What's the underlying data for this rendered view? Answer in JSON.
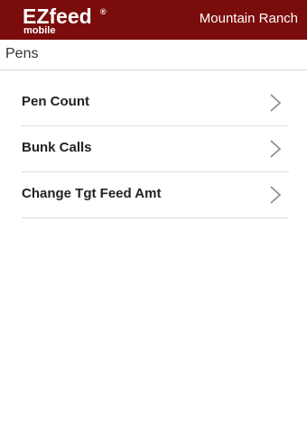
{
  "header": {
    "logo_name": "EZfeed",
    "logo_reg": "®",
    "logo_sub": "mobile",
    "ranch_name": "Mountain Ranch"
  },
  "breadcrumb": {
    "title": "Pens"
  },
  "menu": {
    "items": [
      {
        "label": "Pen Count",
        "icon": "chevron-right-icon"
      },
      {
        "label": "Bunk Calls",
        "icon": "chevron-right-icon"
      },
      {
        "label": "Change Tgt Feed Amt",
        "icon": "chevron-right-icon"
      }
    ]
  },
  "colors": {
    "header_bg": "#7b0c0c",
    "header_text": "#ffffff",
    "divider": "#dcdcdc",
    "chevron": "#8a8a8a"
  }
}
